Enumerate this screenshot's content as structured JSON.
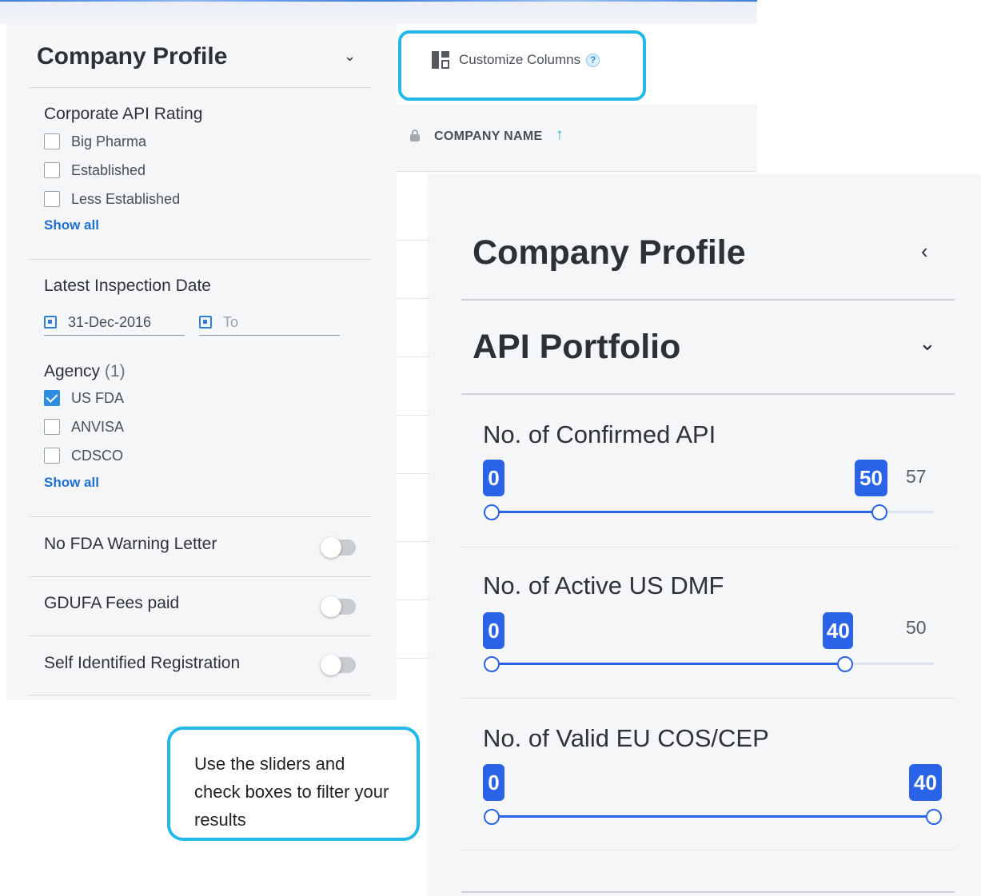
{
  "left_panel": {
    "header": "Company Profile",
    "chevron": "⌄",
    "corporate_rating": {
      "title": "Corporate API Rating",
      "options": [
        {
          "label": "Big Pharma",
          "checked": false
        },
        {
          "label": "Established",
          "checked": false
        },
        {
          "label": "Less Established",
          "checked": false
        }
      ],
      "show_all": "Show all"
    },
    "inspection": {
      "title": "Latest Inspection Date",
      "from_value": "31-Dec-2016",
      "to_placeholder": "To"
    },
    "agency": {
      "title": "Agency",
      "count": "(1)",
      "options": [
        {
          "label": "US FDA",
          "checked": true
        },
        {
          "label": "ANVISA",
          "checked": false
        },
        {
          "label": "CDSCO",
          "checked": false
        }
      ],
      "show_all": "Show all"
    },
    "toggles": [
      {
        "label": "No FDA Warning Letter",
        "on": false
      },
      {
        "label": "GDUFA Fees paid",
        "on": false
      },
      {
        "label": "Self Identified Registration",
        "on": false
      }
    ]
  },
  "table": {
    "customize_label": "Customize Columns",
    "help": "?",
    "column_header": "COMPANY NAME",
    "sort_arrow": "↑"
  },
  "callout": {
    "text": "Use the sliders and check boxes to filter your results"
  },
  "right_panel": {
    "company_profile": "Company Profile",
    "company_chevron": "‹",
    "api_portfolio": "API Portfolio",
    "api_chevron": "⌄",
    "sliders": [
      {
        "title": "No. of Confirmed API",
        "min": "0",
        "max_selected": "50",
        "max": "57",
        "selected_fraction": 0.877
      },
      {
        "title": "No. of Active US DMF",
        "min": "0",
        "max_selected": "40",
        "max": "50",
        "selected_fraction": 0.8
      },
      {
        "title": "No. of Valid EU COS/CEP",
        "min": "0",
        "max_selected": "40",
        "max": "",
        "selected_fraction": 1.0
      }
    ]
  },
  "colors": {
    "accent": "#2b63e8",
    "callout_border": "#22b8e8",
    "link": "#1f6fcf",
    "checkbox_checked": "#2f8de0"
  }
}
